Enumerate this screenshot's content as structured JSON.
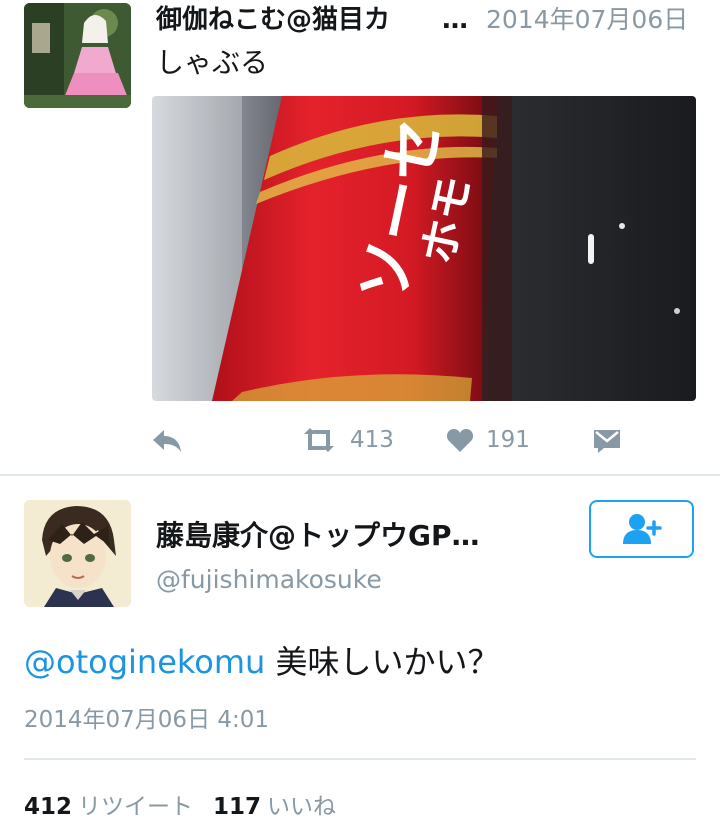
{
  "tweet1": {
    "display_name": "御伽ねこむ@猫目カ",
    "ellipsis": "…",
    "date": "2014年07月06日",
    "text": "しゃぶる",
    "retweet_count": "413",
    "like_count": "191"
  },
  "tweet2": {
    "display_name": "藤島康介@トップウGP…",
    "handle": "@fujishimakosuke",
    "mention": "@otoginekomu",
    "text": " 美味しいかい？",
    "timestamp": "2014年07月06日 4:01",
    "retweets_num": "412",
    "retweets_label": "リツイート",
    "likes_num": "117",
    "likes_label": "いいね"
  },
  "media": {
    "package_text_1": "ソーセ",
    "package_text_2": "ホモ"
  },
  "colors": {
    "accent": "#1da1f2",
    "link": "#1b95e0",
    "muted": "#8899a6",
    "divider": "#e1e8ed"
  },
  "icons": [
    "reply-icon",
    "retweet-icon",
    "heart-icon",
    "direct-message-icon",
    "follow-user-icon"
  ]
}
